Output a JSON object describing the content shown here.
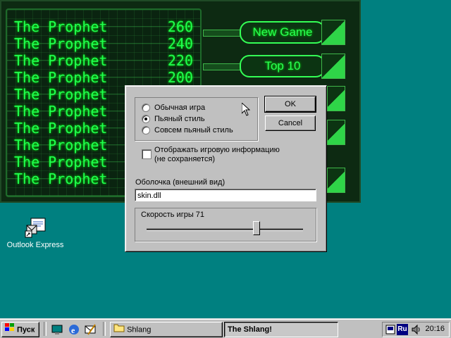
{
  "game": {
    "scores": [
      {
        "name": "The Prophet",
        "score": "260"
      },
      {
        "name": "The Prophet",
        "score": "240"
      },
      {
        "name": "The Prophet",
        "score": "220"
      },
      {
        "name": "The Prophet",
        "score": "200"
      },
      {
        "name": "The Prophet",
        "score": ""
      },
      {
        "name": "The Prophet",
        "score": ""
      },
      {
        "name": "The Prophet",
        "score": ""
      },
      {
        "name": "The Prophet",
        "score": ""
      },
      {
        "name": "The Prophet",
        "score": ""
      },
      {
        "name": "The Prophet",
        "score": ""
      }
    ],
    "buttons": {
      "new_game": "New Game",
      "top10": "Top 10"
    },
    "colors": {
      "text": "#20ff50",
      "bg": "#0d2a12"
    }
  },
  "desktop": {
    "outlook_label": "Outlook Express"
  },
  "dialog": {
    "modes": [
      "Обычная игра",
      "Пьяный стиль",
      "Совсем пьяный стиль"
    ],
    "selected_mode": 1,
    "ok_label": "OK",
    "cancel_label": "Cancel",
    "show_info_label_1": "Отображать игровую информацию",
    "show_info_label_2": "(не сохраняется)",
    "skin_label": "Оболочка (внешний вид)",
    "skin_value": "skin.dll",
    "speed_label": "Скорость игры  71",
    "speed_value": 71
  },
  "taskbar": {
    "start_label": "Пуск",
    "tasks": [
      {
        "label": "Shlang",
        "icon": "folder-icon"
      },
      {
        "label": "The Shlang!",
        "icon": "none"
      }
    ],
    "tray": {
      "lang": "Ru",
      "time": "20:16"
    }
  }
}
